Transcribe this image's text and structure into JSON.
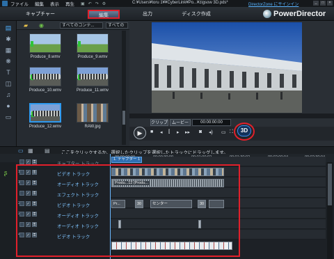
{
  "menu": {
    "items": [
      "ファイル",
      "編集",
      "表示",
      "再生"
    ],
    "doc_title": "C:¥Users¥toru 1¥¥CyberLink¥Po...¥zigsow 3D.pds*",
    "directorzone_link": "DirectorZone にサインイン"
  },
  "tabs": {
    "capture": "キャプチャー",
    "edit": "編集",
    "produce": "出力",
    "disc": "ディスク作成"
  },
  "logo": {
    "text": "PowerDirector"
  },
  "library": {
    "content_dropdown": "すべてのコンテ...",
    "sort_dropdown": "すべての",
    "items": [
      {
        "name": "Produce_8.wmv",
        "thumb": "field"
      },
      {
        "name": "Produce_9.wmv",
        "thumb": "field"
      },
      {
        "name": "Produce_10.wmv",
        "thumb": "hall"
      },
      {
        "name": "Produce_11.wmv",
        "thumb": "hall"
      },
      {
        "name": "Produce_12.wmv",
        "thumb": "hall",
        "selected": true
      },
      {
        "name": "RAW.jpg",
        "thumb": "grid"
      }
    ]
  },
  "preview": {
    "clip_label": "クリップ",
    "movie_label": "ムービー",
    "timecode": "00:00:00:00",
    "btn_3d": "3D"
  },
  "timeline": {
    "hint": "ここをクリックするか、選択したクリップを選択したトラックにドラッグします。",
    "ruler": [
      "00;00;00;00",
      "00;00;30;00",
      "00;01;00;02",
      "00;01;30;02",
      "00;02;00;04",
      "00;02;30;04"
    ],
    "chapter_marker": "1. チャプター 1",
    "tracks": [
      {
        "name": "チャプター トラック",
        "dim": true,
        "num": ""
      },
      {
        "name": "ビデオ トラック",
        "dim": false,
        "num": "1"
      },
      {
        "name": "オーディオ トラック",
        "dim": false,
        "num": "1"
      },
      {
        "name": "エフェクト トラック",
        "dim": false,
        "num": ""
      },
      {
        "name": "ビデオ トラック",
        "dim": false,
        "num": "2"
      },
      {
        "name": "オーディオ トラック",
        "dim": false,
        "num": "2"
      },
      {
        "name": "オーディオ トラック",
        "dim": false,
        "num": ""
      },
      {
        "name": "ビデオ トラック",
        "dim": false,
        "num": "4"
      }
    ],
    "clip_audio_label": "Produ...12 (Produ...",
    "clip_a": "Pr...",
    "clip_b": "30",
    "clip_c": "センター",
    "clip_d": "30"
  },
  "colors": {
    "accent": "#2e9af0",
    "highlight": "#e2202b"
  }
}
